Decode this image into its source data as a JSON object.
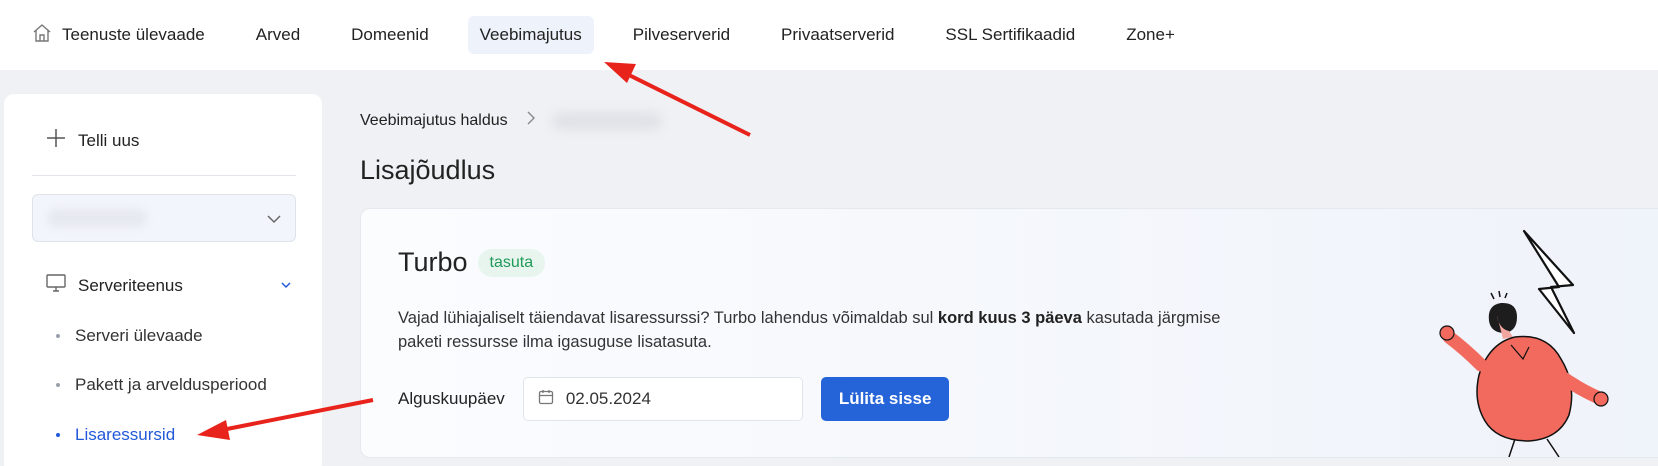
{
  "topnav": {
    "items": [
      {
        "label": "Teenuste ülevaade",
        "icon": "home-icon"
      },
      {
        "label": "Arved"
      },
      {
        "label": "Domeenid"
      },
      {
        "label": "Veebimajutus",
        "active": true
      },
      {
        "label": "Pilveserverid"
      },
      {
        "label": "Privaatserverid"
      },
      {
        "label": "SSL Sertifikaadid"
      },
      {
        "label": "Zone+"
      }
    ]
  },
  "sidebar": {
    "new_order_label": "Telli uus",
    "section_label": "Serveriteenus",
    "items": [
      {
        "label": "Serveri ülevaade"
      },
      {
        "label": "Pakett ja arveldusperiood"
      },
      {
        "label": "Lisaressursid",
        "active": true
      }
    ]
  },
  "breadcrumb": {
    "root": "Veebimajutus haldus"
  },
  "page": {
    "title": "Lisajõudlus"
  },
  "turbo": {
    "title": "Turbo",
    "badge": "tasuta",
    "desc_before": "Vajad lühiajaliselt täiendavat lisaressurssi? Turbo lahendus võimaldab sul ",
    "desc_bold": "kord kuus 3 päeva",
    "desc_after": " kasutada järgmise paketi ressursse ilma igasuguse lisatasuta.",
    "start_label": "Alguskuupäev",
    "start_date": "02.05.2024",
    "button_label": "Lülita sisse"
  },
  "colors": {
    "accent": "#2563d9",
    "active_link": "#2159d9",
    "badge_text": "#1f9a5a",
    "arrow": "#e8231c",
    "illustration_shirt": "#f26a5e"
  }
}
